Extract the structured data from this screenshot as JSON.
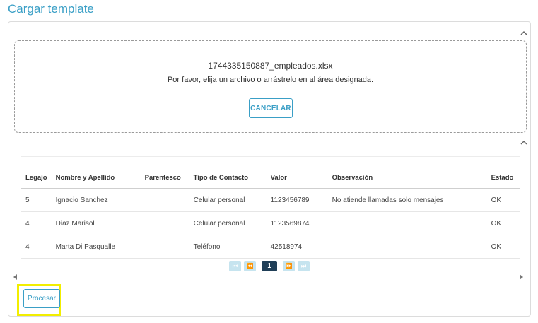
{
  "page": {
    "title": "Cargar template"
  },
  "upload": {
    "filename": "1744335150887_empleados.xlsx",
    "hint": "Por favor, elija un archivo o arrástrelo en al área designada.",
    "cancel_label": "CANCELAR"
  },
  "table": {
    "columns": [
      "Legajo",
      "Nombre y Apellido",
      "Parentesco",
      "Tipo de Contacto",
      "Valor",
      "Observación",
      "Estado"
    ],
    "rows": [
      [
        "5",
        "Ignacio Sanchez",
        "",
        "Celular personal",
        "1123456789",
        "No atiende llamadas solo mensajes",
        "OK"
      ],
      [
        "4",
        "Diaz Marisol",
        "",
        "Celular personal",
        "1123569874",
        "",
        "OK"
      ],
      [
        "4",
        "Marta Di Pasqualle",
        "",
        "Teléfono",
        "42518974",
        "",
        "OK"
      ]
    ]
  },
  "pagination": {
    "first": "⏮",
    "prev": "⏪",
    "current": "1",
    "next": "⏩",
    "last": "⏭"
  },
  "actions": {
    "process_label": "Procesar"
  },
  "colors": {
    "accent": "#3a9fc6",
    "pager_active": "#1f3e57",
    "highlight": "#f2ee00"
  },
  "icons": [
    "chevron-up-icon",
    "scroll-left-icon",
    "scroll-right-icon"
  ]
}
